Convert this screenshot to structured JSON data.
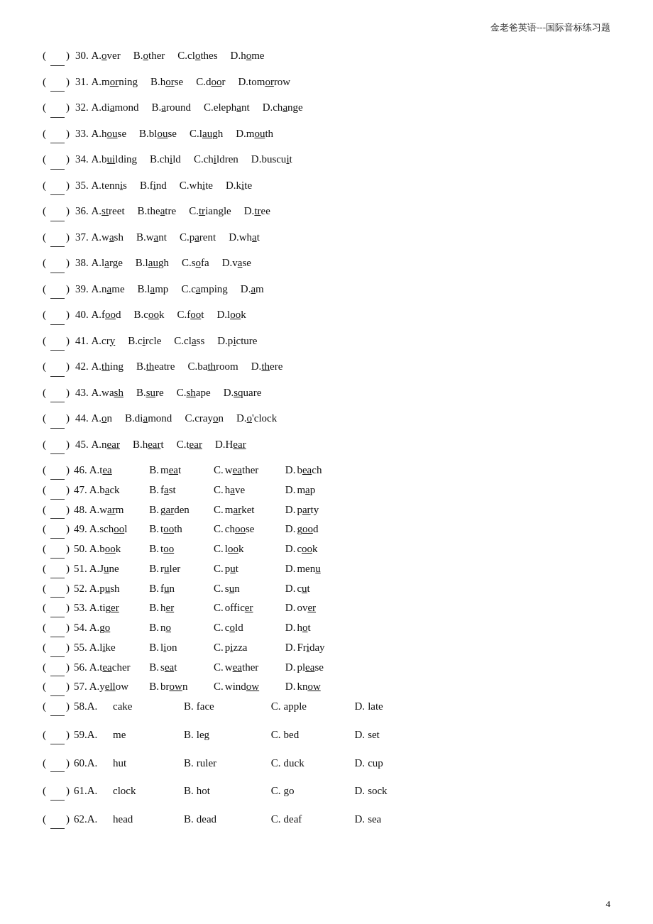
{
  "header": {
    "title": "金老爸英语---国际音标练习题"
  },
  "questions": [
    {
      "num": "30",
      "style": "compact_nodot",
      "items": [
        "A.<u>o</u>ver",
        "B.<u>o</u>ther",
        "C.cl<u>o</u>thes",
        "D.h<u>o</u>me"
      ]
    },
    {
      "num": "31",
      "style": "compact_nodot",
      "items": [
        "A.m<u>or</u>ning",
        "B.h<u>or</u>se",
        "C.d<u>oo</u>r",
        "D.tom<u>or</u>row"
      ]
    },
    {
      "num": "32",
      "style": "compact_nodot",
      "items": [
        "A.di<u>a</u>mond",
        "B.<u>a</u>round",
        "C.eleph<u>a</u>nt",
        "D.ch<u>a</u>nge"
      ]
    },
    {
      "num": "33",
      "style": "compact_nodot",
      "items": [
        "A.h<u>ou</u>se",
        "B.bl<u>ou</u>se",
        "C.l<u>au</u>gh",
        "D.m<u>ou</u>th"
      ]
    },
    {
      "num": "34",
      "style": "compact_nodot",
      "items": [
        "A.b<u>ui</u>lding",
        "B.ch<u>i</u>ld",
        "C.ch<u>i</u>ldren",
        "D.buscu<u>i</u>t"
      ]
    },
    {
      "num": "35",
      "style": "compact_nodot",
      "items": [
        "A.tenn<u>i</u>s",
        "B.f<u>i</u>nd",
        "C.wh<u>i</u>te",
        "D.k<u>i</u>te"
      ]
    },
    {
      "num": "36",
      "style": "compact_nodot",
      "items": [
        "A.<u>st</u>reet",
        "B.the<u>a</u>tre",
        "C.<u>tr</u>iangle",
        "D.<u>tr</u>ee"
      ]
    },
    {
      "num": "37",
      "style": "compact_nodot",
      "items": [
        "A.w<u>a</u>sh",
        "B.w<u>a</u>nt",
        "C.p<u>a</u>rent",
        "D.wh<u>a</u>t"
      ]
    },
    {
      "num": "38",
      "style": "compact_nodot",
      "items": [
        "A.l<u>a</u>rge",
        "B.l<u>au</u>gh",
        "C.s<u>o</u>fa",
        "D.v<u>a</u>se"
      ]
    },
    {
      "num": "39",
      "style": "compact_nodot",
      "items": [
        "A.n<u>a</u>me",
        "B.l<u>a</u>mp",
        "C.c<u>a</u>mping",
        "D.<u>a</u>m"
      ]
    },
    {
      "num": "40",
      "style": "compact_nodot",
      "items": [
        "A.f<u>oo</u>d",
        "B.c<u>oo</u>k",
        "C.f<u>oo</u>t",
        "D.l<u>oo</u>k"
      ]
    },
    {
      "num": "41",
      "style": "compact_nodot",
      "items": [
        "A.cr<u>y</u>",
        "B.c<u>i</u>rcle",
        "C.cl<u>a</u>ss",
        "D.p<u>i</u>cture"
      ]
    },
    {
      "num": "42",
      "style": "compact_nodot",
      "items": [
        "A.<u>th</u>ing",
        "B.<u>th</u>eatre",
        "C.ba<u>th</u>room",
        "D.<u>th</u>ere"
      ]
    },
    {
      "num": "43",
      "style": "compact_nodot",
      "items": [
        "A.wa<u>sh</u>",
        "B.<u>su</u>re",
        "C.<u>sh</u>ape",
        "D.<u>sq</u>uare"
      ]
    },
    {
      "num": "44",
      "style": "compact_nodot",
      "items": [
        "A.<u>o</u>n",
        "B.di<u>a</u>mond",
        "C.cray<u>o</u>n",
        "D.<u>o</u>'clock"
      ]
    },
    {
      "num": "45",
      "style": "compact_nodot",
      "items": [
        "A.n<u>ear</u>",
        "B.h<u>ear</u>t",
        "C.t<u>ear</u>",
        "D.H<u>ear</u>"
      ]
    },
    {
      "num": "46",
      "style": "spaced_dot",
      "A": "tea",
      "B": "meat",
      "C": "weather",
      "D": "beach"
    },
    {
      "num": "47",
      "style": "spaced_dot",
      "A": "back",
      "B": "fast",
      "C": "have",
      "D": "map"
    },
    {
      "num": "48",
      "style": "spaced_dot",
      "A": "warm",
      "B": "garden",
      "C": "market",
      "D": "party"
    },
    {
      "num": "49",
      "style": "spaced_dot",
      "A": "school",
      "B": "tooth",
      "C": "choose",
      "D": "good"
    },
    {
      "num": "50",
      "style": "spaced_dot",
      "A": "book",
      "B": "too",
      "C": "look",
      "D": "cook"
    },
    {
      "num": "51",
      "style": "spaced_dot",
      "A": "June",
      "B": "ruler",
      "C": "put",
      "D": "menu"
    },
    {
      "num": "52",
      "style": "spaced_dot",
      "A": "push",
      "B": "fun",
      "C": "sun",
      "D": "cut"
    },
    {
      "num": "53",
      "style": "spaced_dot",
      "A": "tiger",
      "B": "her",
      "C": "officer",
      "D": "over"
    },
    {
      "num": "54",
      "style": "spaced_dot",
      "A": "go",
      "B": "no",
      "C": "cold",
      "D": "hot"
    },
    {
      "num": "55",
      "style": "spaced_dot",
      "A": "like",
      "B": "lion",
      "C": "pizza",
      "D": "Friday"
    },
    {
      "num": "56",
      "style": "spaced_dot",
      "A": "teacher",
      "B": "seat",
      "C": "weather",
      "D": "please"
    },
    {
      "num": "57",
      "style": "spaced_dot",
      "A": "yellow",
      "B": "brown",
      "C": "window",
      "D": "know"
    },
    {
      "num": "58",
      "style": "wide_dot",
      "A": "cake",
      "B": "face",
      "C": "apple",
      "D": "late"
    },
    {
      "num": "59",
      "style": "wide_dot",
      "A": "me",
      "B": "leg",
      "C": "bed",
      "D": "set"
    },
    {
      "num": "60",
      "style": "wide_dot",
      "A": "hut",
      "B": "ruler",
      "C": "duck",
      "D": "cup"
    },
    {
      "num": "61",
      "style": "wide_dot",
      "A": "clock",
      "B": "hot",
      "C": "go",
      "D": "sock"
    },
    {
      "num": "62",
      "style": "wide_dot",
      "A": "head",
      "B": "dead",
      "C": "deaf",
      "D": "sea"
    }
  ],
  "page_num": "4"
}
